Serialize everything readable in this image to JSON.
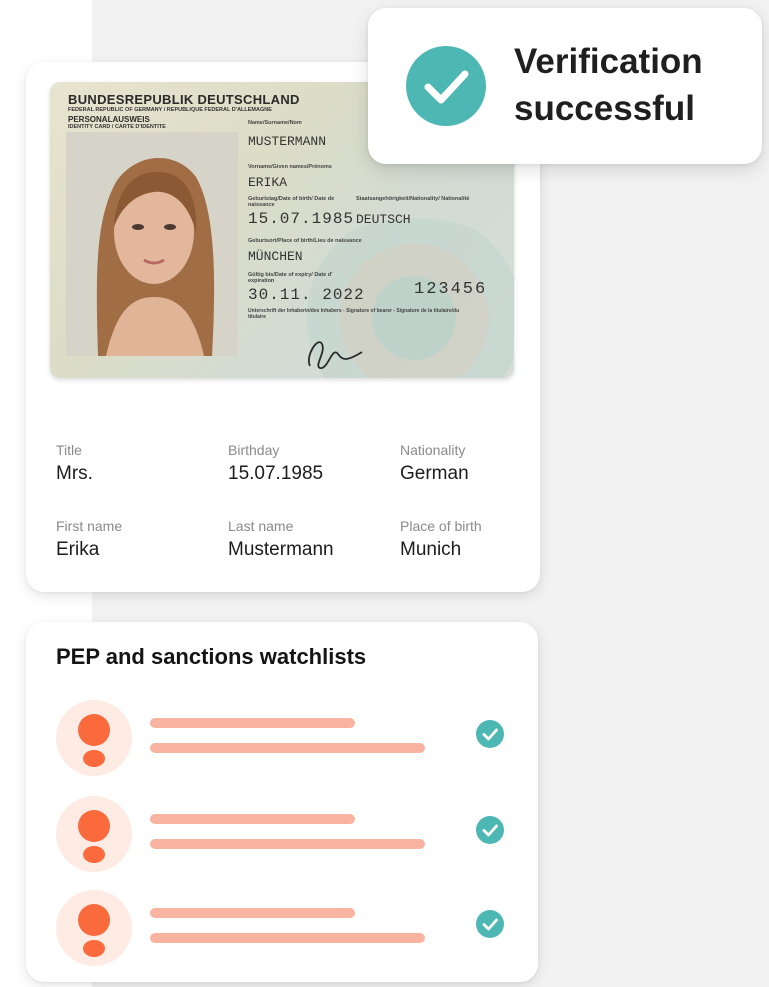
{
  "verification": {
    "line1": "Verification",
    "line2": "successful",
    "icon": "check-circle-icon",
    "accent_color": "#4db8b3"
  },
  "id_document": {
    "country": "BUNDESREPUBLIK DEUTSCHLAND",
    "country_sub": "FEDERAL REPUBLIC OF GERMANY / REPUBLIQUE FEDERAL D'ALLEMAGNE",
    "type": "PERSONALAUSWEIS",
    "type_sub": "IDENTITY CARD / CARTE D'IDENTITE",
    "surname_label": "Name/Surname/Nom",
    "surname": "MUSTERMANN",
    "given_names_label": "Vorname/Given names/Prénoms",
    "given_names": "ERIKA",
    "dob_label": "Geburtstag/Date of birth/ Date de naissance",
    "dob": "15.07.1985",
    "nationality_label": "Staatsangehörigkeit/Nationality/ Nationalité",
    "nationality": "DEUTSCH",
    "pob_label": "Geburtsort/Place of birth/Lieu de naissance",
    "pob": "MÜNCHEN",
    "expiry_label": "Gültig bis/Date of expiry/ Date d' expiration",
    "expiry": "30.11. 2022",
    "card_number": "123456",
    "signature_label": "Unterschrift der Inhaberin/des Inhabers - Signature of bearer - Signature de la titulaire/du titulaire"
  },
  "details": {
    "title_label": "Title",
    "title_value": "Mrs.",
    "birthday_label": "Birthday",
    "birthday_value": "15.07.1985",
    "nationality_label": "Nationality",
    "nationality_value": "German",
    "first_name_label": "First name",
    "first_name_value": "Erika",
    "last_name_label": "Last name",
    "last_name_value": "Mustermann",
    "place_of_birth_label": "Place of birth",
    "place_of_birth_value": "Munich"
  },
  "watchlist": {
    "title": "PEP and sanctions watchlists",
    "row_count_visible": 3,
    "person_color": "#fa6a3c",
    "line_color": "#f9b3a1",
    "check_color": "#4db8b3"
  }
}
